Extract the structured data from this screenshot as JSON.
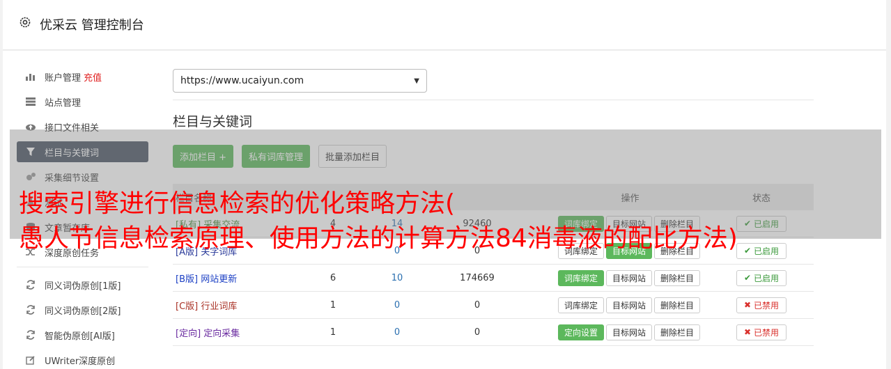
{
  "header": {
    "title": "优采云 管理控制台",
    "icon": "gear-icon"
  },
  "sidebar": {
    "items": [
      {
        "label": "账户管理",
        "extra": "充值",
        "icon": "bar-chart-icon"
      },
      {
        "label": "站点管理",
        "icon": "server-icon"
      },
      {
        "label": "接口文件相关",
        "icon": "cloud-upload-icon"
      },
      {
        "label": "栏目与关键词",
        "icon": "filter-icon",
        "active": true
      },
      {
        "label": "采集细节设置",
        "icon": "gears-icon"
      },
      {
        "label": "测试",
        "icon": "flask-icon"
      },
      {
        "label": "文章暂存库",
        "icon": "database-icon"
      },
      {
        "label": "深度原创任务",
        "icon": "shuffle-icon"
      }
    ],
    "items2": [
      {
        "label": "同义词伪原创[1版]",
        "icon": "refresh-icon"
      },
      {
        "label": "同义词伪原创[2版]",
        "icon": "refresh-icon"
      },
      {
        "label": "智能伪原创[AI版]",
        "icon": "refresh-icon"
      },
      {
        "label": "UWriter深度原创",
        "icon": "edit-icon"
      }
    ]
  },
  "main": {
    "url_select": "https://www.ucaiyun.com",
    "section_title": "栏目与关键词",
    "buttons": {
      "add_column": "添加栏目 +",
      "private_lib": "私有词库管理",
      "batch_add": "批量添加栏目"
    },
    "table": {
      "headers": {
        "name": "栏目名称",
        "ops": "操作",
        "state": "状态"
      },
      "rows": [
        {
          "tag": "[私有]",
          "name": "采集交流",
          "n1": "4",
          "n2": "14",
          "n3": "92460",
          "op1": "词库绑定",
          "op2": "目标网站",
          "op3": "删除栏目",
          "state": "已启用"
        },
        {
          "tag": "[A版]",
          "name": "关字词库",
          "n1": "",
          "n2": "0",
          "n3": "0",
          "op1": "词库绑定",
          "op2": "目标网站",
          "op3": "删除栏目",
          "state": "已启用"
        },
        {
          "tag": "[B版]",
          "name": "网站更新",
          "n1": "6",
          "n2": "10",
          "n3": "174669",
          "op1": "词库绑定",
          "op2": "目标网站",
          "op3": "删除栏目",
          "state": "已启用"
        },
        {
          "tag": "[C版]",
          "name": "行业词库",
          "n1": "1",
          "n2": "0",
          "n3": "0",
          "op1": "词库绑定",
          "op2": "目标网站",
          "op3": "删除栏目",
          "state": "已禁用"
        },
        {
          "tag": "[定向]",
          "name": "定向采集",
          "n1": "1",
          "n2": "0",
          "n3": "0",
          "op1": "定向设置",
          "op2": "目标网站",
          "op3": "删除栏目",
          "state": "已禁用"
        }
      ]
    }
  },
  "overlay": {
    "line1": "搜索引擎进行信息检索的优化策略方法(",
    "line2": "愚人节信息检索原理、使用方法的计算方法84消毒液的配比方法)"
  }
}
